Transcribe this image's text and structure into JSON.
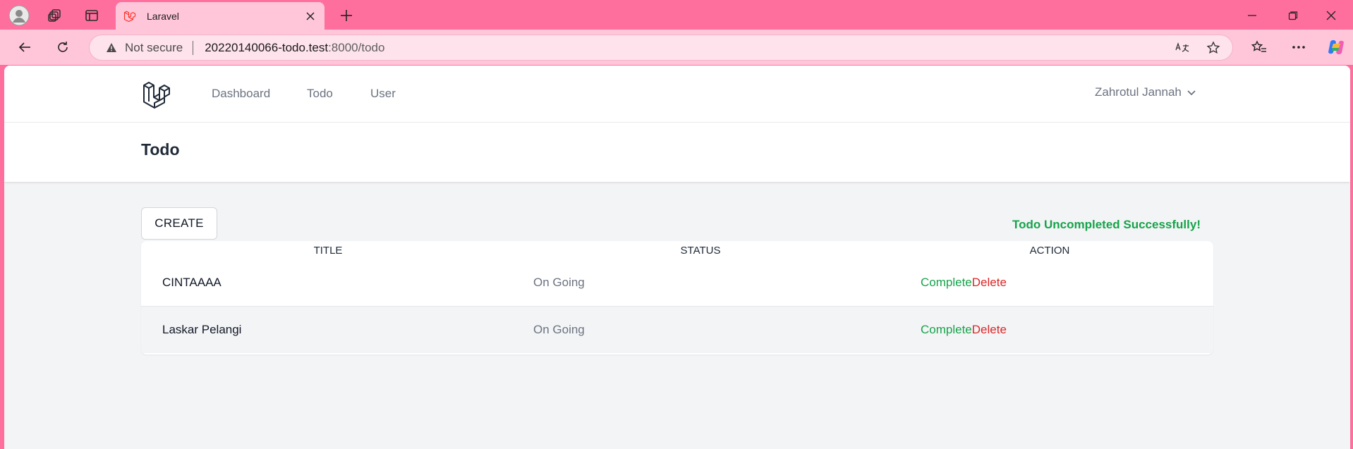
{
  "browser": {
    "tab": {
      "title": "Laravel"
    },
    "address": {
      "security_label": "Not secure",
      "url_host": "20220140066-todo.test",
      "url_rest": ":8000/todo"
    }
  },
  "nav": {
    "links": [
      {
        "label": "Dashboard"
      },
      {
        "label": "Todo"
      },
      {
        "label": "User"
      }
    ],
    "user_name": "Zahrotul Jannah"
  },
  "header": {
    "title": "Todo"
  },
  "actions": {
    "create_label": "CREATE"
  },
  "flash": {
    "message": "Todo Uncompleted Successfully!"
  },
  "table": {
    "columns": [
      "TITLE",
      "STATUS",
      "ACTION"
    ],
    "rows": [
      {
        "title": "CINTAAAA",
        "status": "On Going",
        "complete_label": "Complete",
        "delete_label": "Delete"
      },
      {
        "title": "Laskar Pelangi",
        "status": "On Going",
        "complete_label": "Complete",
        "delete_label": "Delete"
      }
    ]
  },
  "colors": {
    "browser_accent": "#ff6f9e",
    "success": "#16a34a",
    "danger": "#dc2626",
    "page_bg": "#f3f4f6"
  }
}
